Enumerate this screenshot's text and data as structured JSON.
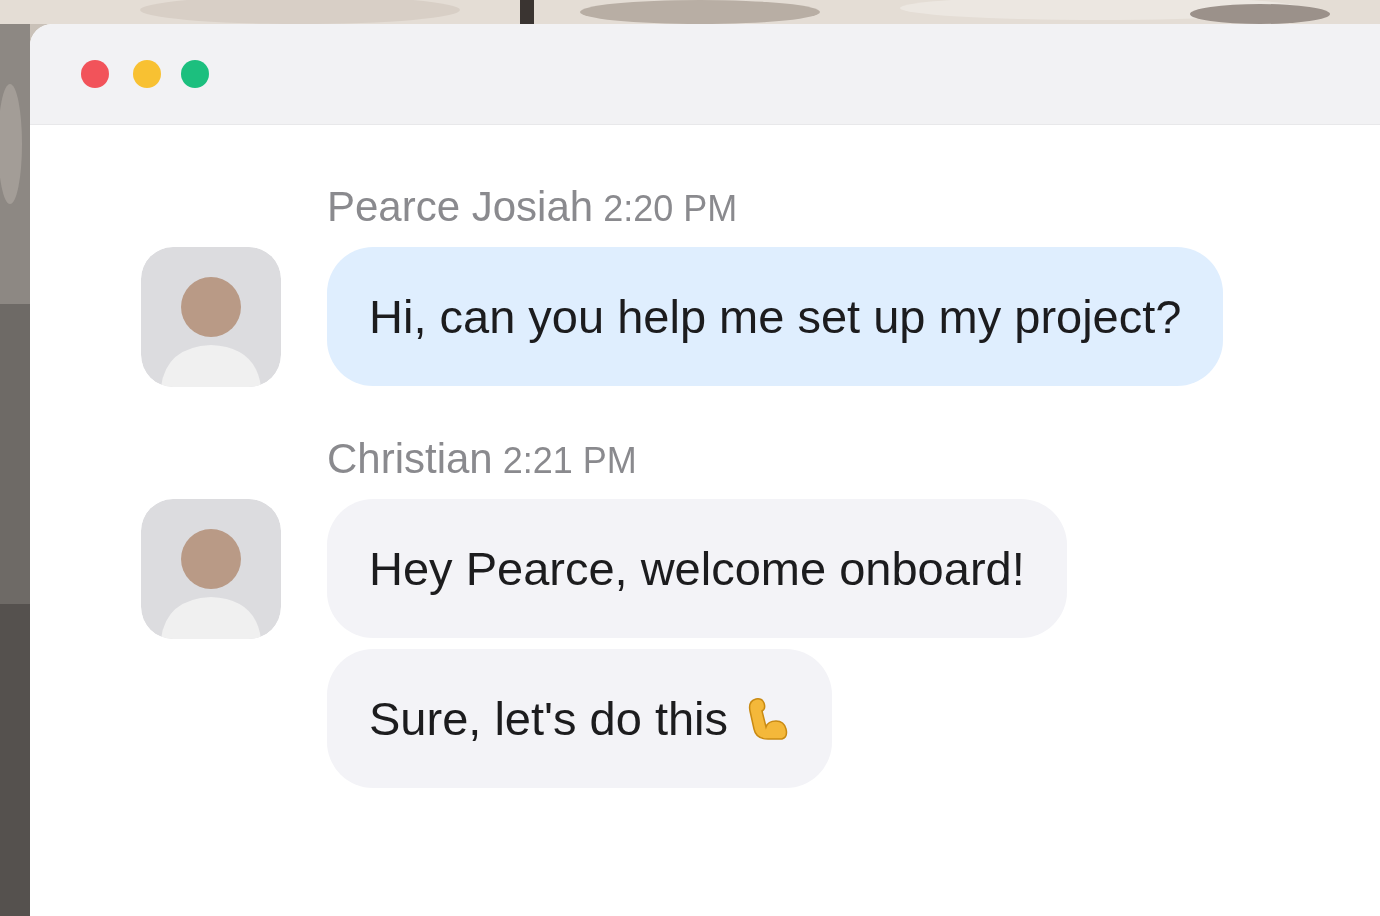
{
  "conversation": [
    {
      "sender": "Pearce Josiah",
      "time": "2:20 PM",
      "color": "#dfeefe",
      "messages": [
        {
          "kind": "plain",
          "text": "Hi, can you help me set up my project?"
        }
      ]
    },
    {
      "sender": "Christian",
      "time": "2:21 PM",
      "color": "#f3f3f7",
      "messages": [
        {
          "kind": "plain",
          "text": "Hey Pearce, welcome onboard!"
        },
        {
          "kind": "flex",
          "text": "Sure, let's do this"
        }
      ]
    }
  ]
}
